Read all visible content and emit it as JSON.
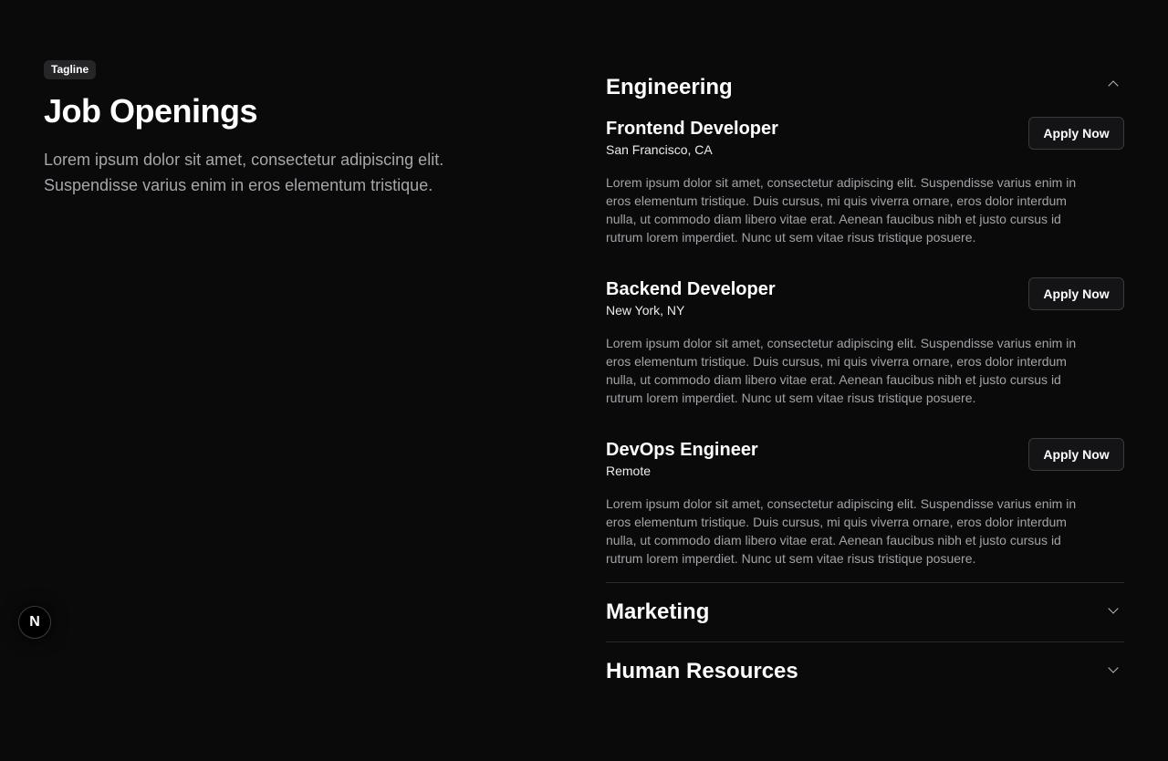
{
  "hero": {
    "tagline": "Tagline",
    "title": "Job Openings",
    "description": "Lorem ipsum dolor sit amet, consectetur adipiscing elit. Suspendisse varius enim in eros elementum tristique."
  },
  "departments": [
    {
      "name": "Engineering",
      "expanded": true,
      "jobs": [
        {
          "title": "Frontend Developer",
          "location": "San Francisco, CA",
          "description": "Lorem ipsum dolor sit amet, consectetur adipiscing elit. Suspendisse varius enim in eros elementum tristique. Duis cursus, mi quis viverra ornare, eros dolor interdum nulla, ut commodo diam libero vitae erat. Aenean faucibus nibh et justo cursus id rutrum lorem imperdiet. Nunc ut sem vitae risus tristique posuere.",
          "apply_label": "Apply Now"
        },
        {
          "title": "Backend Developer",
          "location": "New York, NY",
          "description": "Lorem ipsum dolor sit amet, consectetur adipiscing elit. Suspendisse varius enim in eros elementum tristique. Duis cursus, mi quis viverra ornare, eros dolor interdum nulla, ut commodo diam libero vitae erat. Aenean faucibus nibh et justo cursus id rutrum lorem imperdiet. Nunc ut sem vitae risus tristique posuere.",
          "apply_label": "Apply Now"
        },
        {
          "title": "DevOps Engineer",
          "location": "Remote",
          "description": "Lorem ipsum dolor sit amet, consectetur adipiscing elit. Suspendisse varius enim in eros elementum tristique. Duis cursus, mi quis viverra ornare, eros dolor interdum nulla, ut commodo diam libero vitae erat. Aenean faucibus nibh et justo cursus id rutrum lorem imperdiet. Nunc ut sem vitae risus tristique posuere.",
          "apply_label": "Apply Now"
        }
      ]
    },
    {
      "name": "Marketing",
      "expanded": false
    },
    {
      "name": "Human Resources",
      "expanded": false
    }
  ],
  "badge": {
    "letter": "N",
    "icon": "nextjs-logo-icon"
  },
  "colors": {
    "background": "#0a0a0b",
    "muted_text": "#a6a6ab",
    "border": "#2a2a2e"
  }
}
